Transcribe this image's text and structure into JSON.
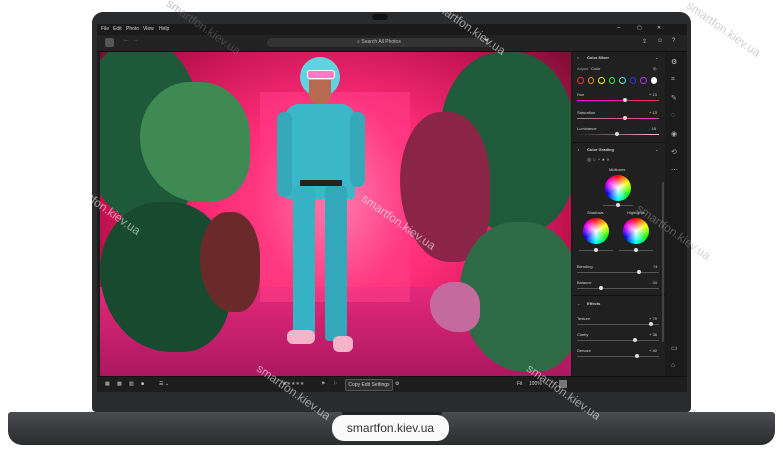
{
  "menu": {
    "items": [
      "File",
      "Edit",
      "Photo",
      "View",
      "Help"
    ]
  },
  "toolbar": {
    "search_placeholder": "Search All Photos"
  },
  "color_mixer": {
    "title": "Color Mixer",
    "adjust_label": "Adjust",
    "adjust_value": "Color",
    "hue_label": "Hue",
    "hue_value": "+ 13",
    "saturation_label": "Saturation",
    "saturation_value": "+ 13",
    "luminance_label": "Luminance",
    "luminance_value": "- 18"
  },
  "color_grading": {
    "title": "Color Grading",
    "midtones_label": "Midtones",
    "shadows_label": "Shadows",
    "highlights_label": "Highlights",
    "blending_label": "Blending",
    "blending_value": "74",
    "balance_label": "Balance",
    "balance_value": "- 34"
  },
  "effects": {
    "title": "Effects",
    "texture_label": "Texture",
    "texture_value": "+ 79",
    "clarity_label": "Clarity",
    "clarity_value": "+ 38",
    "dehaze_label": "Dehaze",
    "dehaze_value": "+ 40"
  },
  "bottom": {
    "copy_edit": "Copy Edit Settings",
    "fit_label": "Fit",
    "zoom_value": "100%"
  },
  "watermark": {
    "text": "smartfon.kiev.ua"
  },
  "colors": {
    "bezel": "#2a2b2d",
    "panel": "#202020",
    "backdrop": "#ff2d78"
  }
}
